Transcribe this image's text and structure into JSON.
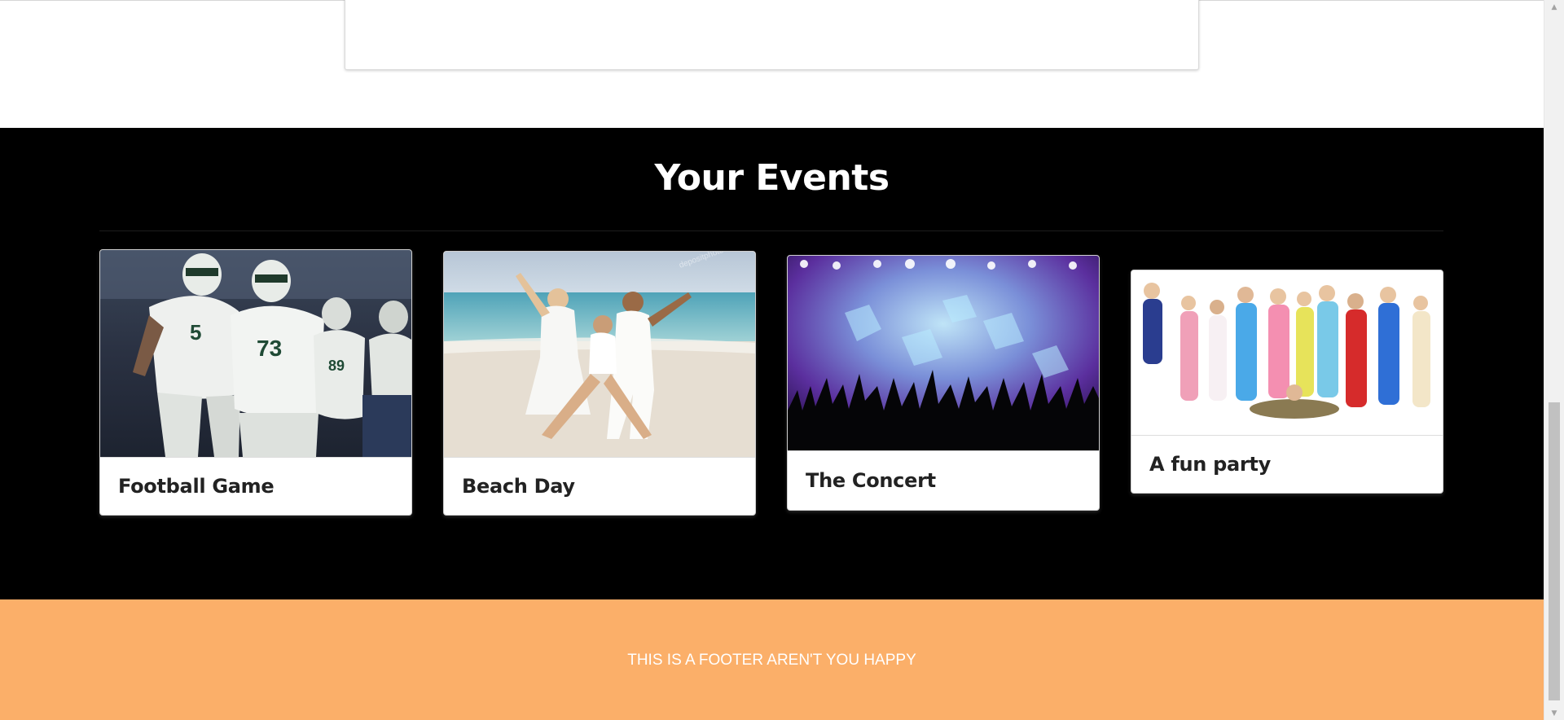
{
  "events": {
    "title": "Your Events",
    "items": [
      {
        "name": "Football Game",
        "image": "football-players-photo"
      },
      {
        "name": "Beach Day",
        "image": "beach-people-photo"
      },
      {
        "name": "The Concert",
        "image": "concert-crowd-photo"
      },
      {
        "name": "A fun party",
        "image": "pajama-party-photo"
      }
    ]
  },
  "footer": {
    "text": "THIS IS A FOOTER AREN'T YOU HAPPY",
    "color": "#fbaf69"
  },
  "scrollbar": {
    "up_glyph": "▲",
    "down_glyph": "▼"
  },
  "colors": {
    "events_bg": "#000000",
    "footer_bg": "#fbaf69"
  }
}
